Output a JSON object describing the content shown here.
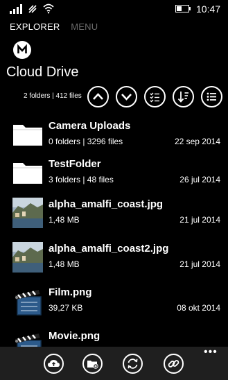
{
  "status": {
    "time": "10:47"
  },
  "pivot": {
    "active": "EXPLORER",
    "inactive": "MENU"
  },
  "page": {
    "title": "Cloud Drive",
    "count": "2 folders | 412 files"
  },
  "toolbar": {
    "icons": [
      "chevron-up-icon",
      "chevron-down-icon",
      "multi-select-icon",
      "sort-icon",
      "list-view-icon"
    ]
  },
  "items": [
    {
      "name": "Camera Uploads",
      "meta": "0 folders | 3296 files",
      "date": "22 sep 2014",
      "type": "folder"
    },
    {
      "name": "TestFolder",
      "meta": "3 folders | 48 files",
      "date": "26 jul 2014",
      "type": "folder"
    },
    {
      "name": "alpha_amalfi_coast.jpg",
      "meta": "1,48 MB",
      "date": "21 jul 2014",
      "type": "image"
    },
    {
      "name": "alpha_amalfi_coast2.jpg",
      "meta": "1,48 MB",
      "date": "21 jul 2014",
      "type": "image"
    },
    {
      "name": "Film.png",
      "meta": "39,27 KB",
      "date": "08 okt 2014",
      "type": "clapper"
    },
    {
      "name": "Movie.png",
      "meta": "",
      "date": "",
      "type": "clapper"
    }
  ],
  "app_bar": {
    "icons": [
      "upload-icon",
      "new-folder-icon",
      "refresh-icon",
      "link-icon"
    ],
    "more": "•••"
  }
}
